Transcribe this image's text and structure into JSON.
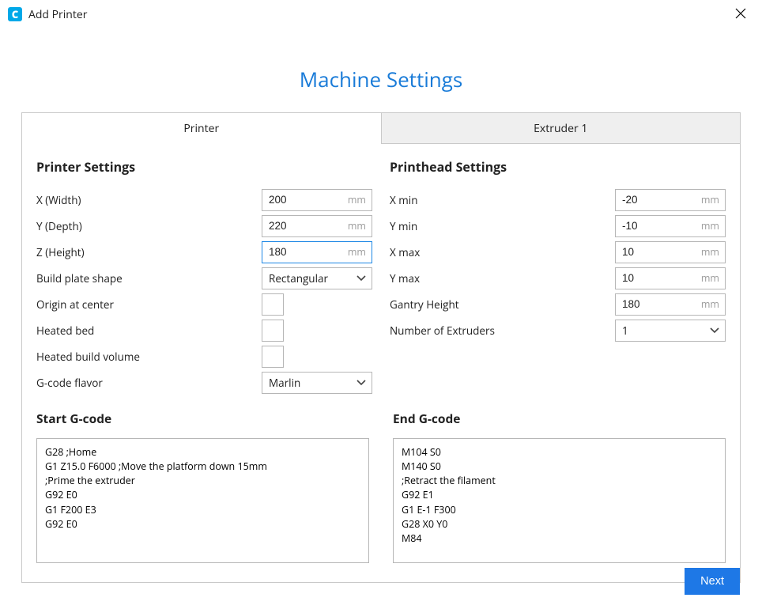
{
  "window": {
    "title": "Add Printer",
    "app_icon_letter": "C"
  },
  "heading": "Machine Settings",
  "tabs": {
    "printer": "Printer",
    "extruder1": "Extruder 1"
  },
  "printer_settings": {
    "title": "Printer Settings",
    "rows": {
      "x_width": {
        "label": "X (Width)",
        "value": "200",
        "unit": "mm"
      },
      "y_depth": {
        "label": "Y (Depth)",
        "value": "220",
        "unit": "mm"
      },
      "z_height": {
        "label": "Z (Height)",
        "value": "180",
        "unit": "mm"
      },
      "build_plate": {
        "label": "Build plate shape",
        "value": "Rectangular"
      },
      "origin_center": {
        "label": "Origin at center"
      },
      "heated_bed": {
        "label": "Heated bed"
      },
      "heated_volume": {
        "label": "Heated build volume"
      },
      "gcode_flavor": {
        "label": "G-code flavor",
        "value": "Marlin"
      }
    }
  },
  "printhead_settings": {
    "title": "Printhead Settings",
    "rows": {
      "x_min": {
        "label": "X min",
        "value": "-20",
        "unit": "mm"
      },
      "y_min": {
        "label": "Y min",
        "value": "-10",
        "unit": "mm"
      },
      "x_max": {
        "label": "X max",
        "value": "10",
        "unit": "mm"
      },
      "y_max": {
        "label": "Y max",
        "value": "10",
        "unit": "mm"
      },
      "gantry": {
        "label": "Gantry Height",
        "value": "180",
        "unit": "mm"
      },
      "extruders": {
        "label": "Number of Extruders",
        "value": "1"
      }
    }
  },
  "start_gcode": {
    "title": "Start G-code",
    "content": "G28 ;Home\nG1 Z15.0 F6000 ;Move the platform down 15mm\n;Prime the extruder\nG92 E0\nG1 F200 E3\nG92 E0"
  },
  "end_gcode": {
    "title": "End G-code",
    "content": "M104 S0\nM140 S0\n;Retract the filament\nG92 E1\nG1 E-1 F300\nG28 X0 Y0\nM84"
  },
  "buttons": {
    "next": "Next"
  }
}
